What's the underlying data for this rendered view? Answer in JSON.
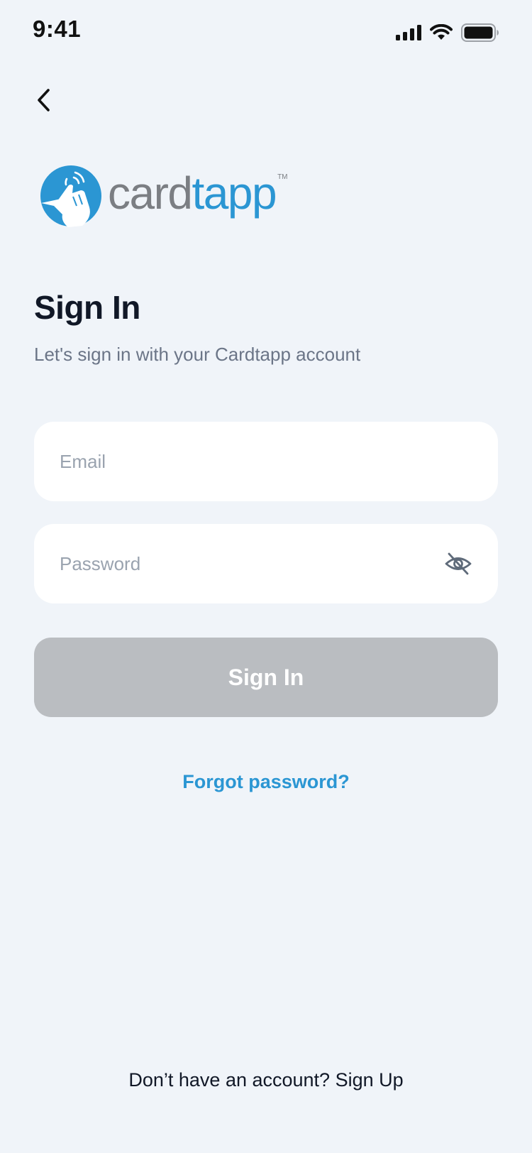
{
  "status_bar": {
    "time": "9:41",
    "icons": [
      "cellular-signal-icon",
      "wifi-icon",
      "battery-icon"
    ]
  },
  "nav": {
    "back_icon": "chevron-left-icon"
  },
  "logo": {
    "mark_icon": "tap-hand-icon",
    "text_gray": "card",
    "text_blue": "tapp",
    "trademark": "TM",
    "colors": {
      "blue": "#2B96D3",
      "gray": "#7B7E83"
    }
  },
  "heading": {
    "title": "Sign In",
    "subtitle": "Let's sign in with your Cardtapp account"
  },
  "form": {
    "email": {
      "placeholder": "Email",
      "value": ""
    },
    "password": {
      "placeholder": "Password",
      "value": "",
      "toggle_icon": "eye-off-icon"
    },
    "submit_label": "Sign In",
    "forgot_label": "Forgot password?"
  },
  "footer": {
    "prompt": "Don’t have an account?",
    "signup_label": "Sign Up"
  },
  "colors": {
    "background": "#F0F4F9",
    "button_disabled": "#BABDC1",
    "link": "#2B96D3"
  }
}
